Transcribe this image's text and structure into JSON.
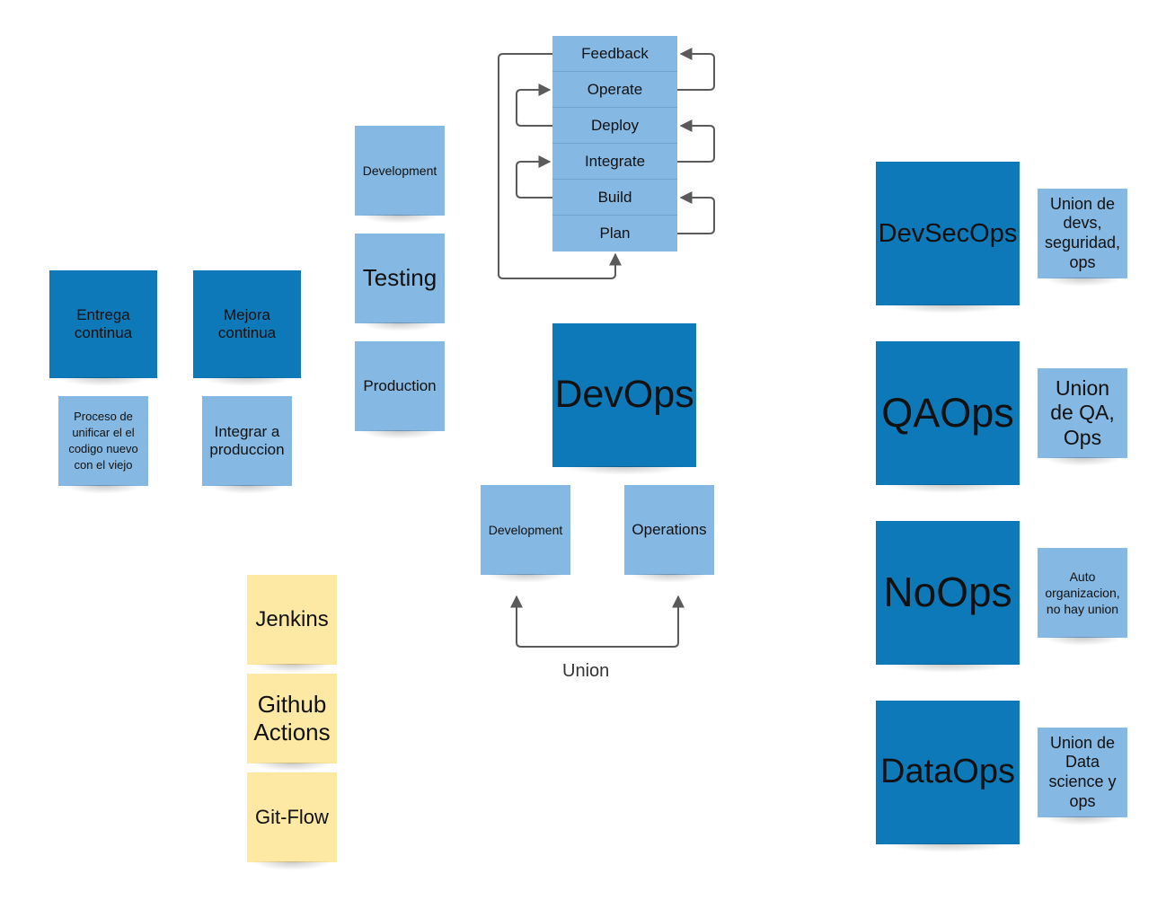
{
  "colors": {
    "dark": "#0d79b9",
    "light": "#85b8e2",
    "yellow": "#fde8a4",
    "connector": "#5a5a5a"
  },
  "cycle": {
    "stages": [
      "Feedback",
      "Operate",
      "Deploy",
      "Integrate",
      "Build",
      "Plan"
    ]
  },
  "pipeline": {
    "development": "Development",
    "testing": "Testing",
    "production": "Production"
  },
  "practices": [
    {
      "title": "Entrega continua",
      "description": "Proceso de unificar el el codigo nuevo con el viejo"
    },
    {
      "title": "Mejora continua",
      "description": "Integrar a produccion"
    }
  ],
  "devops": {
    "title": "DevOps",
    "development": "Development",
    "operations": "Operations",
    "union_label": "Union"
  },
  "tools": [
    "Jenkins",
    "Github Actions",
    "Git-Flow"
  ],
  "variants": [
    {
      "name": "DevSecOps",
      "description": "Union de devs, seguridad, ops"
    },
    {
      "name": "QAOps",
      "description": "Union de QA, Ops"
    },
    {
      "name": "NoOps",
      "description": "Auto organizacion, no hay union"
    },
    {
      "name": "DataOps",
      "description": "Union de Data science y ops"
    }
  ]
}
